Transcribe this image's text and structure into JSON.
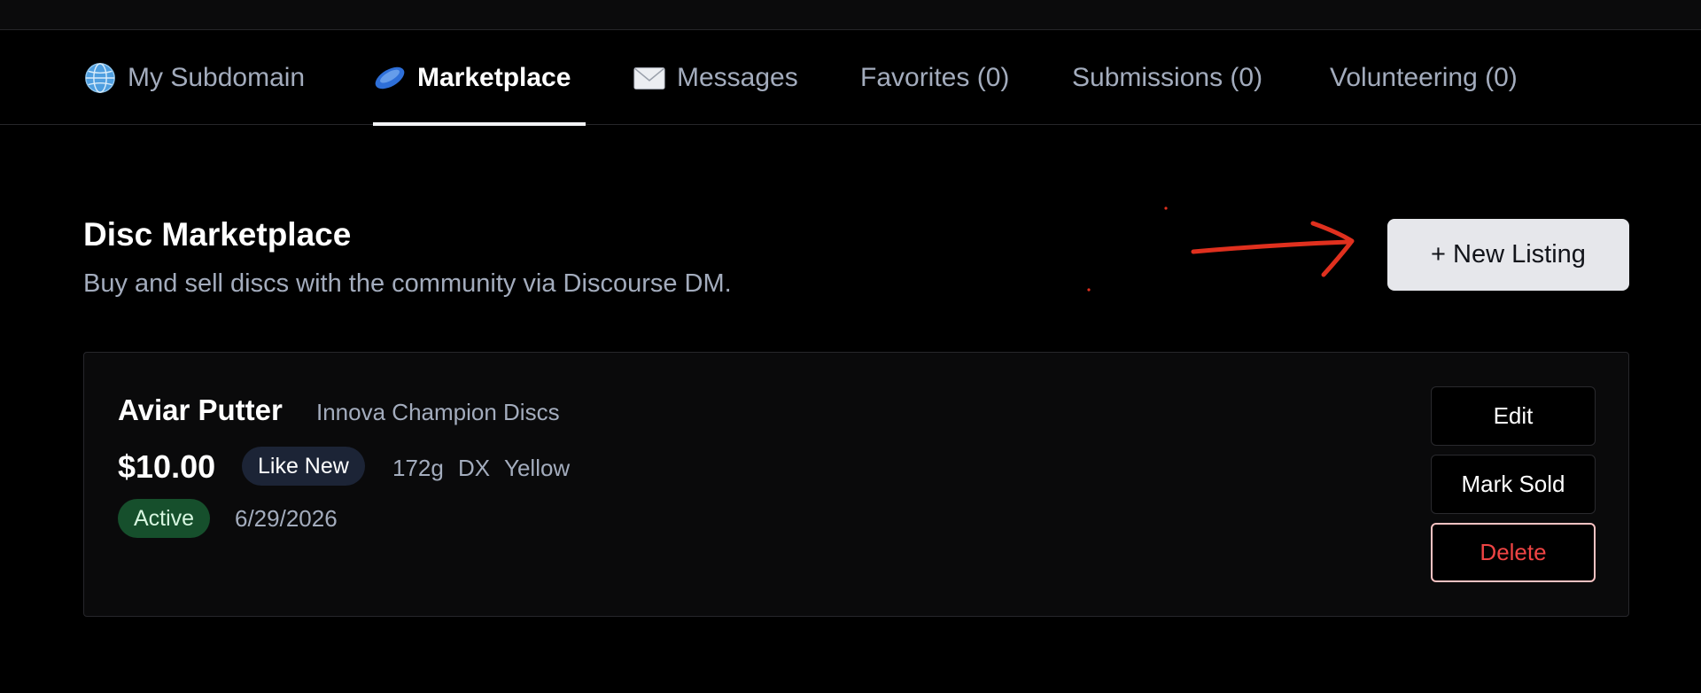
{
  "tabs": [
    {
      "label": "My Subdomain",
      "icon": "globe-icon"
    },
    {
      "label": "Marketplace",
      "icon": "disc-icon"
    },
    {
      "label": "Messages",
      "icon": "envelope-icon"
    },
    {
      "label": "Favorites (0)"
    },
    {
      "label": "Submissions (0)"
    },
    {
      "label": "Volunteering (0)"
    }
  ],
  "header": {
    "title": "Disc Marketplace",
    "subtitle": "Buy and sell discs with the community via Discourse DM.",
    "new_listing_label": "+ New Listing"
  },
  "listing": {
    "name": "Aviar Putter",
    "brand": "Innova Champion Discs",
    "price": "$10.00",
    "condition": "Like New",
    "weight": "172g",
    "plastic": "DX",
    "color": "Yellow",
    "status": "Active",
    "date": "6/29/2026",
    "actions": {
      "edit": "Edit",
      "mark_sold": "Mark Sold",
      "delete": "Delete"
    }
  },
  "colors": {
    "accent_active_tab": "#f3f4f6",
    "danger": "#ef4444",
    "status_active": "#164f2c",
    "annotation_arrow": "#e0301e"
  }
}
